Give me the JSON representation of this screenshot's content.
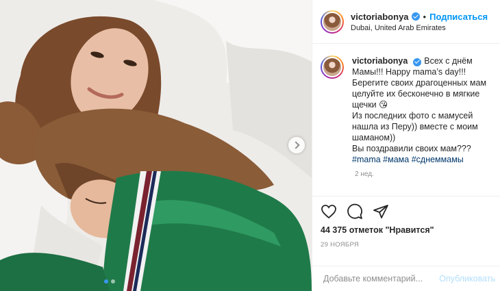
{
  "post": {
    "username": "victoriabonya",
    "follow_label": "Подписаться",
    "separator": "•",
    "location": "Dubai, United Arab Emirates"
  },
  "caption": {
    "username": "victoriabonya",
    "lines": [
      "Всех с днём Мамы!!! Happy mama’s day!!! Берегите своих драгоценных мам целуйте их бесконечно в мягкие щечки 😘",
      "Из последних фото с мамусей нашла из Перу)) вместе с моим шаманом))",
      "Вы поздравили своих мам???"
    ],
    "hashtags": [
      "#mama",
      "#мама",
      "#сднеммамы"
    ],
    "time_ago": "2 нед."
  },
  "actions": {
    "like_icon": "heart-icon",
    "comment_icon": "comment-bubble-icon",
    "share_icon": "paper-plane-icon",
    "likes_text": "44 375 отметок \"Нравится\"",
    "date": "29 ноября"
  },
  "comment": {
    "placeholder": "Добавьте комментарий...",
    "publish_label": "Опубликовать"
  },
  "carousel": {
    "slide_count": 2,
    "active_slide": 1
  },
  "colors": {
    "link_blue": "#0095f6",
    "hashtag": "#00376b",
    "muted": "#8e8e8e",
    "publish_disabled": "#b2dffc"
  }
}
